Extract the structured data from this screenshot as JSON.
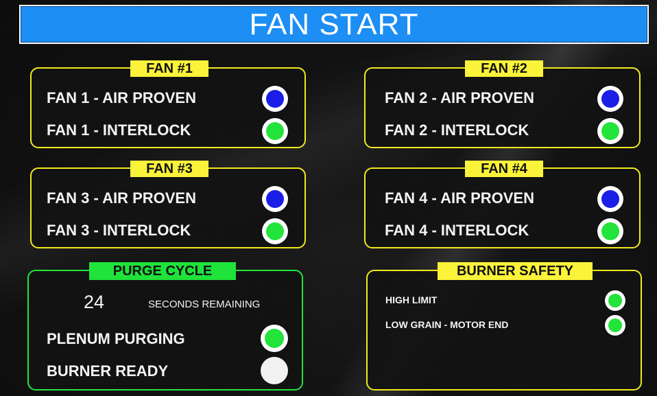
{
  "header": {
    "title": "FAN START"
  },
  "colors": {
    "title_bar": "#1c8ef4",
    "panel_border": "#f2ea1f",
    "purge_border": "#22e63a",
    "indicator_blue": "#1a1ee6",
    "indicator_green": "#22e43a",
    "indicator_off": "#f2f2f2"
  },
  "fan1": {
    "label": "FAN #1",
    "air_proven": {
      "label": "FAN 1 - AIR PROVEN",
      "indicator": "blue"
    },
    "interlock": {
      "label": "FAN 1 - INTERLOCK",
      "indicator": "green"
    }
  },
  "fan2": {
    "label": "FAN #2",
    "air_proven": {
      "label": "FAN 2 - AIR PROVEN",
      "indicator": "blue"
    },
    "interlock": {
      "label": "FAN 2 - INTERLOCK",
      "indicator": "green"
    }
  },
  "fan3": {
    "label": "FAN #3",
    "air_proven": {
      "label": "FAN 3 - AIR PROVEN",
      "indicator": "blue"
    },
    "interlock": {
      "label": "FAN 3 - INTERLOCK",
      "indicator": "green"
    }
  },
  "fan4": {
    "label": "FAN #4",
    "air_proven": {
      "label": "FAN 4 - AIR PROVEN",
      "indicator": "blue"
    },
    "interlock": {
      "label": "FAN 4 - INTERLOCK",
      "indicator": "green"
    }
  },
  "purge": {
    "label": "PURGE CYCLE",
    "seconds": "24",
    "seconds_label": "SECONDS REMAINING",
    "plenum_purging": {
      "label": "PLENUM PURGING",
      "indicator": "green"
    },
    "burner_ready": {
      "label": "BURNER READY",
      "indicator": "off"
    }
  },
  "burner_safety": {
    "label": "BURNER SAFETY",
    "high_limit": {
      "label": "HIGH LIMIT",
      "indicator": "green"
    },
    "low_grain": {
      "label": "LOW GRAIN - MOTOR END",
      "indicator": "green"
    }
  }
}
